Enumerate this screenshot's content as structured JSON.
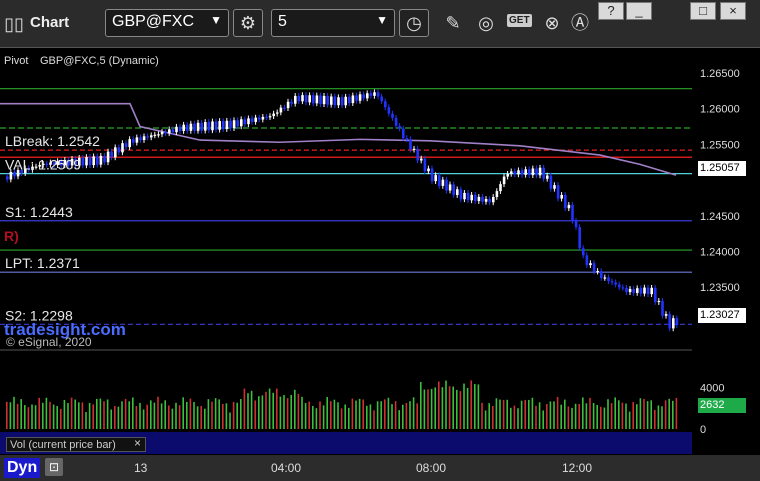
{
  "toolbar": {
    "title": "Chart",
    "symbol": "GBP@FXC",
    "interval": "5",
    "get_label": "GET"
  },
  "window_buttons": [
    "?",
    "_",
    "□",
    "×"
  ],
  "overlay": {
    "legend": "GBP@FXC,5 (Dynamic)",
    "pivot_label": "Pivot",
    "watermark": "tradesight.com",
    "copyright": "© eSignal, 2020",
    "vol_label": "Vol (current price bar)",
    "footer_label": "Dyn"
  },
  "current_price": "1.25057",
  "last_price": "1.23027",
  "volume_last": "2632",
  "chart_data": {
    "type": "candlestick",
    "x_ticks": [
      "13",
      "04:00",
      "08:00",
      "12:00"
    ],
    "y_ticks": [
      1.265,
      1.26,
      1.255,
      1.25,
      1.245,
      1.24,
      1.235,
      1.23
    ],
    "y_tick_labels": [
      "1.26500",
      "1.26000",
      "1.25500",
      "1.25057",
      "1.24500",
      "1.24000",
      "1.23500",
      "1.23027"
    ],
    "ylim": [
      1.2262,
      1.2678
    ],
    "levels": [
      {
        "name": "LBreak",
        "label": "LBreak: 1.2542",
        "value": 1.2542,
        "color": "#e02020",
        "style": "dashed"
      },
      {
        "name": "VAL",
        "label": "VAL: 1.2509",
        "value": 1.2509,
        "color": "#4fd1d9",
        "style": "solid"
      },
      {
        "name": "S1",
        "label": "S1: 1.2443",
        "value": 1.2443,
        "color": "#3a3ad6",
        "style": "solid"
      },
      {
        "name": "LPT",
        "label": "LPT: 1.2371",
        "value": 1.2371,
        "color": "#6a7ad8",
        "style": "solid"
      },
      {
        "name": "S2",
        "label": "S2: 1.2298",
        "value": 1.2298,
        "color": "#3a3ad6",
        "style": "dashed"
      }
    ],
    "green_levels": [
      1.2628,
      1.2573,
      1.2402
    ],
    "red_level": 1.2532,
    "marker_r": "R)",
    "volume_ticks": [
      4000,
      0
    ],
    "volume_tick_labels": [
      "4000",
      "0"
    ],
    "volume_last": 2632
  }
}
